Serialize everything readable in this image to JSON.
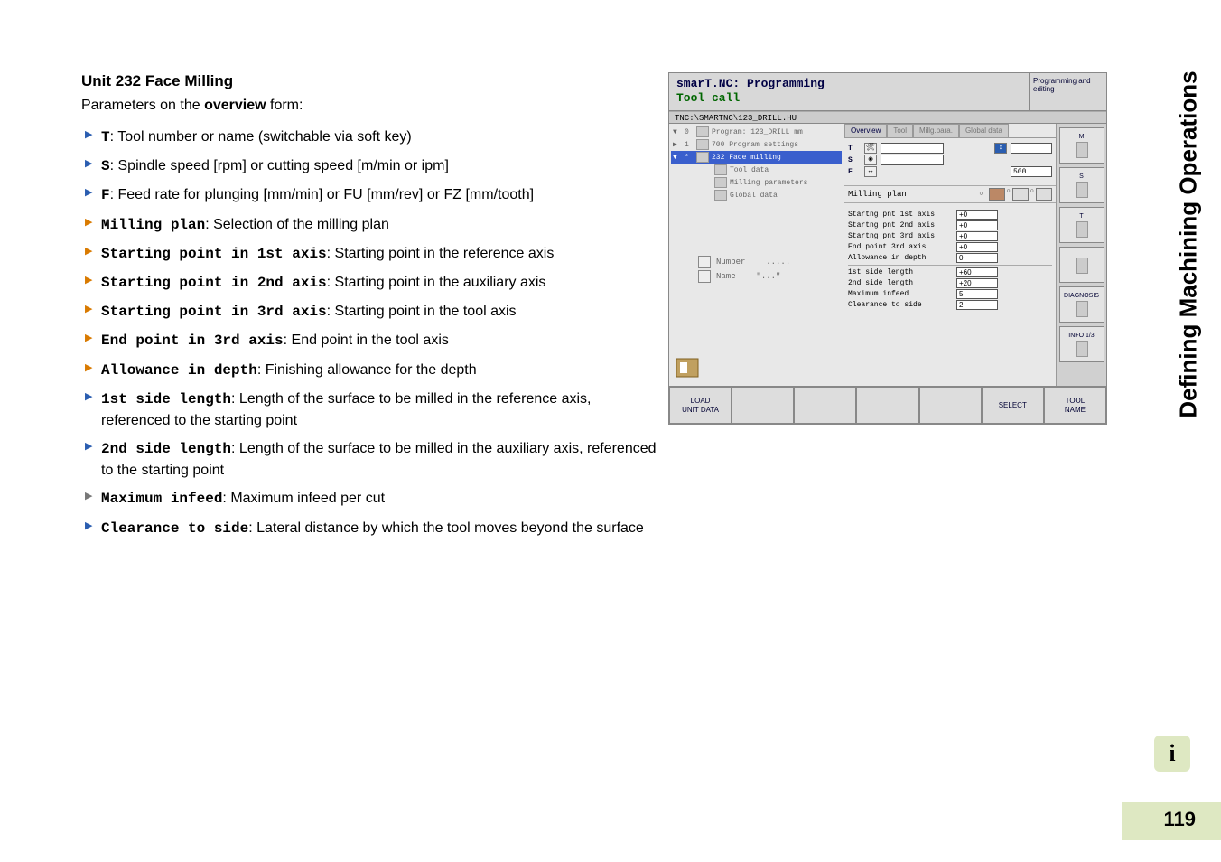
{
  "heading": "Unit 232 Face Milling",
  "intro_pre": "Parameters on the ",
  "intro_bold": "overview",
  "intro_post": " form:",
  "params": [
    {
      "cls": "blue",
      "mono": "T",
      "rest": ": Tool number or name (switchable via soft key)"
    },
    {
      "cls": "blue",
      "mono": "S",
      "rest": ": Spindle speed [rpm] or cutting speed [m/min or ipm]"
    },
    {
      "cls": "blue",
      "mono": "F",
      "rest": ": Feed rate for plunging [mm/min] or FU [mm/rev] or FZ [mm/tooth]"
    },
    {
      "cls": "orange",
      "mono": "Milling plan",
      "rest": ": Selection of the milling plan"
    },
    {
      "cls": "orange",
      "mono": "Starting point in 1st axis",
      "rest": ": Starting point in the reference axis"
    },
    {
      "cls": "orange",
      "mono": "Starting point in 2nd axis",
      "rest": ": Starting point in the auxiliary axis"
    },
    {
      "cls": "orange",
      "mono": "Starting point in 3rd axis",
      "rest": ": Starting point in the tool axis"
    },
    {
      "cls": "orange",
      "mono": "End point in 3rd axis",
      "rest": ": End point in the tool axis"
    },
    {
      "cls": "orange",
      "mono": "Allowance in depth",
      "rest": ": Finishing allowance for the depth"
    },
    {
      "cls": "blue",
      "mono": "1st side length",
      "rest": ": Length of the surface to be milled in the reference axis, referenced to the starting point"
    },
    {
      "cls": "blue",
      "mono": "2nd side length",
      "rest": ": Length of the surface to be milled in the auxiliary axis, referenced to the starting point"
    },
    {
      "cls": "gray",
      "mono": "Maximum infeed",
      "rest": ": Maximum infeed per cut"
    },
    {
      "cls": "blue",
      "mono": "Clearance to side",
      "rest": ": Lateral distance by which the tool moves beyond the surface"
    }
  ],
  "side_title": "Defining Machining Operations",
  "info_glyph": "i",
  "page_number": "119",
  "shot": {
    "title_line1": "smarT.NC: Programming",
    "title_line2": "Tool call",
    "mode": "Programming and editing",
    "path": "TNC:\\SMARTNC\\123_DRILL.HU",
    "tree": {
      "items": [
        {
          "toggle": "▼",
          "idx": "0",
          "label": "Program: 123_DRILL mm"
        },
        {
          "toggle": "▶",
          "idx": "1",
          "label": "700 Program settings"
        },
        {
          "toggle": "▼",
          "idx": "*",
          "label": "232 Face milling",
          "sel": true
        },
        {
          "toggle": "",
          "idx": "",
          "label": "Tool data",
          "indent": true
        },
        {
          "toggle": "",
          "idx": "",
          "label": "Milling parameters",
          "indent": true
        },
        {
          "toggle": "",
          "idx": "",
          "label": "Global data",
          "indent": true
        }
      ],
      "number_label": "Number",
      "number_value": ".....",
      "name_label": "Name",
      "name_value": "\"...\""
    },
    "tabs": [
      "Overview",
      "Tool",
      "Millg.para.",
      "Global data"
    ],
    "fields": {
      "T": {
        "lbl": "T",
        "v1": "",
        "v2": ""
      },
      "S": {
        "lbl": "S",
        "v1": ""
      },
      "F": {
        "lbl": "F",
        "v1": "500"
      }
    },
    "plan_label": "Milling plan",
    "param_rows": [
      {
        "lbl": "Startng pnt 1st axis",
        "val": "+0"
      },
      {
        "lbl": "Startng pnt 2nd axis",
        "val": "+0"
      },
      {
        "lbl": "Startng pnt 3rd axis",
        "val": "+0"
      },
      {
        "lbl": "End point 3rd axis",
        "val": "+0"
      },
      {
        "lbl": "Allowance in depth",
        "val": "0"
      },
      {
        "lbl": "1st side length",
        "val": "+60"
      },
      {
        "lbl": "2nd side length",
        "val": "+20"
      },
      {
        "lbl": "Maximum infeed",
        "val": "5"
      },
      {
        "lbl": "Clearance to side",
        "val": "2"
      }
    ],
    "side_buttons": [
      "M",
      "S",
      "T",
      "",
      "DIAGNOSIS",
      "INFO 1/3"
    ],
    "footer": [
      {
        "l1": "LOAD",
        "l2": "UNIT DATA"
      },
      {
        "l1": "",
        "l2": ""
      },
      {
        "l1": "",
        "l2": ""
      },
      {
        "l1": "",
        "l2": ""
      },
      {
        "l1": "",
        "l2": ""
      },
      {
        "l1": "SELECT",
        "l2": ""
      },
      {
        "l1": "TOOL",
        "l2": "NAME"
      }
    ]
  }
}
